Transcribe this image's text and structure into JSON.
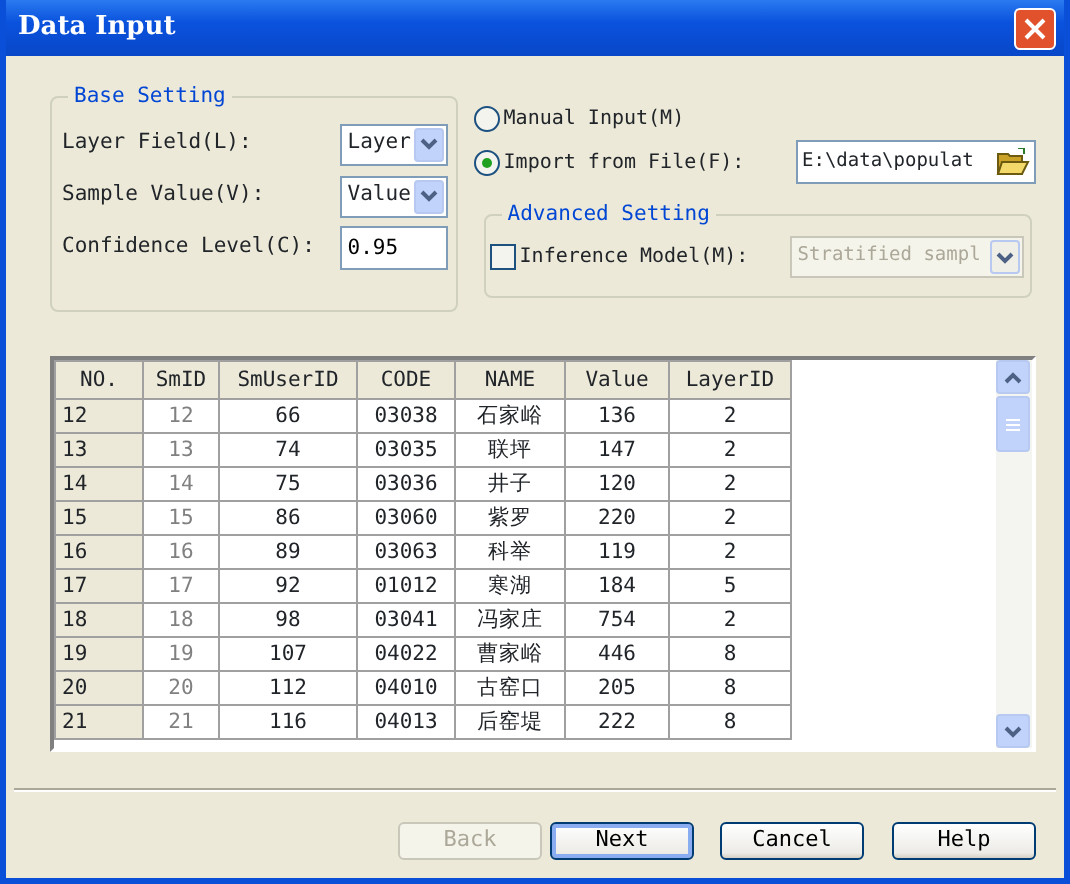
{
  "window": {
    "title": "Data Input"
  },
  "base_setting": {
    "title": "Base Setting",
    "fields": [
      {
        "kind": "select",
        "label": "Layer Field(L):",
        "value": "Layer"
      },
      {
        "kind": "select",
        "label": "Sample Value(V):",
        "value": "Value"
      },
      {
        "kind": "input",
        "label": "Confidence Level(C):",
        "value": "0.95"
      }
    ]
  },
  "source_options": [
    {
      "label": "Manual Input(M)",
      "selected": false
    },
    {
      "label": "Import from File(F):",
      "selected": true
    }
  ],
  "file_path": {
    "value": "E:\\data\\populat"
  },
  "advanced_setting": {
    "title": "Advanced Setting",
    "inference_model": {
      "label": "Inference Model(M):",
      "checked": false,
      "value": "Stratified sampl",
      "disabled": true
    }
  },
  "table": {
    "columns": [
      "NO.",
      "SmID",
      "SmUserID",
      "CODE",
      "NAME",
      "Value",
      "LayerID"
    ],
    "rows": [
      [
        "12",
        "12",
        "66",
        "03038",
        "石家峪",
        "136",
        "2"
      ],
      [
        "13",
        "13",
        "74",
        "03035",
        "联坪",
        "147",
        "2"
      ],
      [
        "14",
        "14",
        "75",
        "03036",
        "井子",
        "120",
        "2"
      ],
      [
        "15",
        "15",
        "86",
        "03060",
        "紫罗",
        "220",
        "2"
      ],
      [
        "16",
        "16",
        "89",
        "03063",
        "科举",
        "119",
        "2"
      ],
      [
        "17",
        "17",
        "92",
        "01012",
        "寒湖",
        "184",
        "5"
      ],
      [
        "18",
        "18",
        "98",
        "03041",
        "冯家庄",
        "754",
        "2"
      ],
      [
        "19",
        "19",
        "107",
        "04022",
        "曹家峪",
        "446",
        "8"
      ],
      [
        "20",
        "20",
        "112",
        "04010",
        "古窑口",
        "205",
        "8"
      ],
      [
        "21",
        "21",
        "116",
        "04013",
        "后窑堤",
        "222",
        "8"
      ]
    ]
  },
  "buttons": [
    {
      "label": "Back",
      "disabled": true,
      "default": false
    },
    {
      "label": "Next",
      "disabled": false,
      "default": true
    },
    {
      "label": "Cancel",
      "disabled": false,
      "default": false
    },
    {
      "label": "Help",
      "disabled": false,
      "default": false
    }
  ]
}
